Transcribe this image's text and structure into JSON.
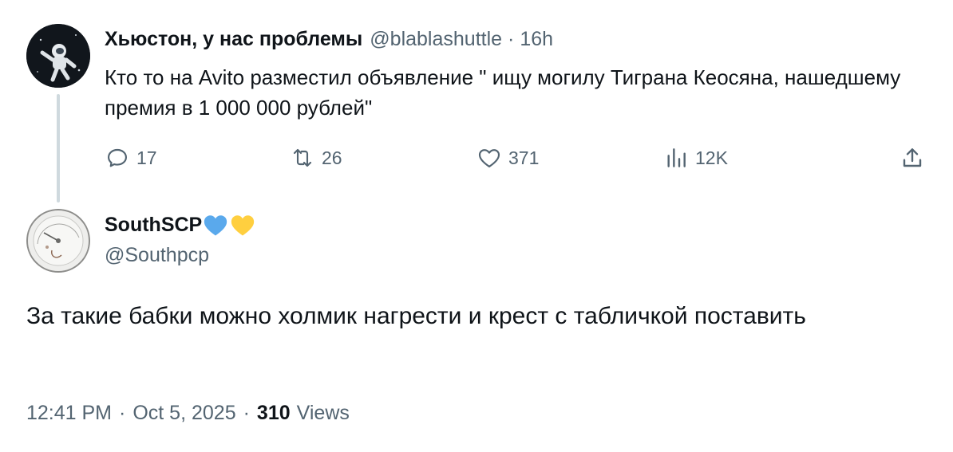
{
  "parent": {
    "name": "Хьюстон, у нас проблемы",
    "handle": "@blablashuttle",
    "time": "16h",
    "text": "Кто то на Avito разместил объявление \" ищу могилу Тиграна Кеосяна, нашедшему премия в 1 000 000 рублей\"",
    "actions": {
      "replies": "17",
      "retweets": "26",
      "likes": "371",
      "views": "12K"
    }
  },
  "reply": {
    "name": "SouthSCP",
    "hearts": [
      "#5aa9ec",
      "#ffcf3f"
    ],
    "handle": "@Southpcp",
    "text": "За такие бабки можно холмик нагрести и крест с табличкой поставить",
    "time": "12:41 PM",
    "date": "Oct 5, 2025",
    "views_count": "310",
    "views_label": "Views"
  },
  "separator": "·",
  "icons": {
    "reply": "reply-icon",
    "retweet": "retweet-icon",
    "like": "heart-icon",
    "views": "views-icon",
    "share": "share-icon"
  }
}
